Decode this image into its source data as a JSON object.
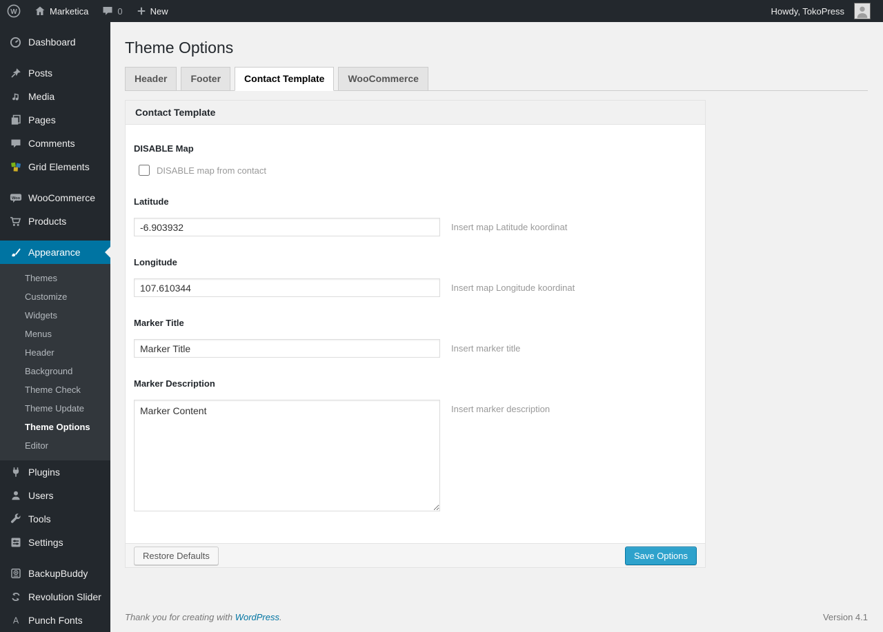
{
  "admin_bar": {
    "site_name": "Marketica",
    "comment_count": "0",
    "new_label": "New",
    "howdy": "Howdy, TokoPress"
  },
  "sidebar": {
    "items": [
      {
        "label": "Dashboard",
        "icon": "dashboard-icon"
      },
      {
        "label": "Posts",
        "icon": "pushpin-icon"
      },
      {
        "label": "Media",
        "icon": "media-icon"
      },
      {
        "label": "Pages",
        "icon": "pages-icon"
      },
      {
        "label": "Comments",
        "icon": "comment-icon"
      },
      {
        "label": "Grid Elements",
        "icon": "grid-icon"
      },
      {
        "label": "WooCommerce",
        "icon": "woo-badge-icon"
      },
      {
        "label": "Products",
        "icon": "cart-icon"
      },
      {
        "label": "Appearance",
        "icon": "paintbrush-icon",
        "active": true
      },
      {
        "label": "Plugins",
        "icon": "plug-icon"
      },
      {
        "label": "Users",
        "icon": "user-icon"
      },
      {
        "label": "Tools",
        "icon": "wrench-icon"
      },
      {
        "label": "Settings",
        "icon": "sliders-icon"
      },
      {
        "label": "BackupBuddy",
        "icon": "backup-disk-icon"
      },
      {
        "label": "Revolution Slider",
        "icon": "cycle-arrows-icon"
      },
      {
        "label": "Punch Fonts",
        "icon": "letter-a-icon"
      }
    ],
    "submenu": [
      "Themes",
      "Customize",
      "Widgets",
      "Menus",
      "Header",
      "Background",
      "Theme Check",
      "Theme Update",
      "Theme Options",
      "Editor"
    ],
    "active_submenu_item": "Theme Options"
  },
  "main": {
    "title": "Theme Options",
    "tabs": [
      {
        "label": "Header",
        "active": false
      },
      {
        "label": "Footer",
        "active": false
      },
      {
        "label": "Contact Template",
        "active": true
      },
      {
        "label": "WooCommerce",
        "active": false
      }
    ]
  },
  "panel": {
    "title": "Contact Template",
    "disable_map": {
      "label": "DISABLE Map",
      "checkbox_label": "DISABLE map from contact",
      "checked": false
    },
    "latitude": {
      "label": "Latitude",
      "value": "-6.903932",
      "hint": "Insert map Latitude koordinat"
    },
    "longitude": {
      "label": "Longitude",
      "value": "107.610344",
      "hint": "Insert map Longitude koordinat"
    },
    "marker_title": {
      "label": "Marker Title",
      "value": "Marker Title",
      "hint": "Insert marker title"
    },
    "marker_description": {
      "label": "Marker Description",
      "value": "Marker Content",
      "hint": "Insert marker description"
    },
    "restore_label": "Restore Defaults",
    "save_label": "Save Options"
  },
  "footer": {
    "thanks_prefix": "Thank you for creating with",
    "thanks_link": "WordPress",
    "thanks_suffix": ".",
    "version": "Version 4.1"
  },
  "colors": {
    "admin_bar_bg": "#23282d",
    "sidebar_bg": "#23282d",
    "submenu_bg": "#32373c",
    "highlight_blue": "#0074a2",
    "primary_button": "#2ea2cc",
    "page_bg": "#f1f1f1"
  }
}
